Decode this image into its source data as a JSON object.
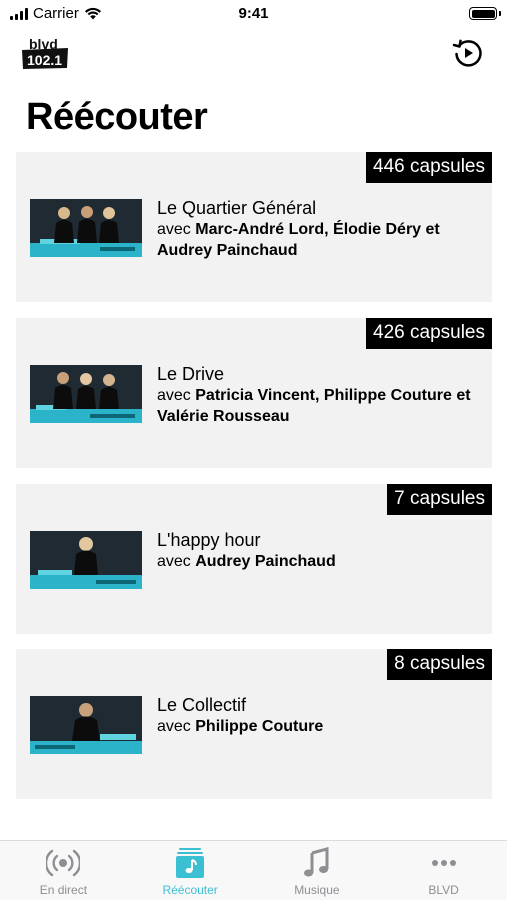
{
  "status_bar": {
    "carrier": "Carrier",
    "time": "9:41"
  },
  "header": {
    "logo_text_top": "blvd",
    "logo_text_bottom": "102.1",
    "history_icon": "replay-history-icon"
  },
  "page_title": "Réécouter",
  "shows": [
    {
      "badge": "446 capsules",
      "title": "Le Quartier Général",
      "prefix": "avec ",
      "hosts": "Marc-André Lord, Élodie Déry et Audrey Painchaud"
    },
    {
      "badge": "426 capsules",
      "title": "Le Drive",
      "prefix": "avec ",
      "hosts": "Patricia Vincent, Philippe Couture et Valérie Rousseau"
    },
    {
      "badge": "7 capsules",
      "title": "L'happy hour",
      "prefix": "avec ",
      "hosts": "Audrey Painchaud"
    },
    {
      "badge": "8 capsules",
      "title": "Le Collectif",
      "prefix": "avec ",
      "hosts": "Philippe Couture"
    }
  ],
  "tabs": [
    {
      "label": "En direct",
      "icon": "broadcast-icon"
    },
    {
      "label": "Réécouter",
      "icon": "playlist-icon",
      "active": true
    },
    {
      "label": "Musique",
      "icon": "music-note-icon"
    },
    {
      "label": "BLVD",
      "icon": "more-dots-icon"
    }
  ],
  "colors": {
    "accent": "#3bbfd3",
    "card_background": "#f2f2f2",
    "inactive_tab": "#8e8e93"
  }
}
